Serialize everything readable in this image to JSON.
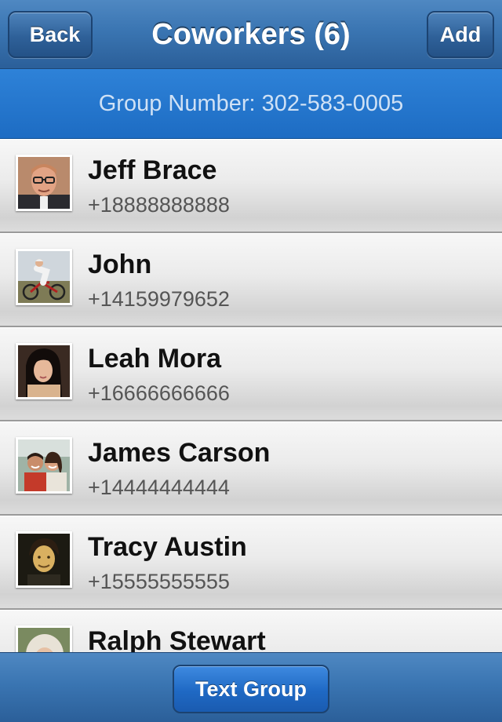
{
  "navbar": {
    "back_label": "Back",
    "title": "Coworkers (6)",
    "add_label": "Add"
  },
  "group": {
    "number_text": "Group Number: 302-583-0005"
  },
  "contacts": [
    {
      "name": "Jeff Brace",
      "phone": "+18888888888",
      "avatar": "avatar-man-glasses"
    },
    {
      "name": "John",
      "phone": "+14159979652",
      "avatar": "avatar-cyclist"
    },
    {
      "name": "Leah Mora",
      "phone": "+16666666666",
      "avatar": "avatar-woman-dark-hair"
    },
    {
      "name": "James Carson",
      "phone": "+14444444444",
      "avatar": "avatar-two-people-outdoors"
    },
    {
      "name": "Tracy Austin",
      "phone": "+15555555555",
      "avatar": "avatar-man-dark-background"
    },
    {
      "name": "Ralph Stewart",
      "phone": "",
      "avatar": "avatar-light-haired"
    }
  ],
  "toolbar": {
    "text_group_label": "Text Group"
  },
  "colors": {
    "nav_blue": "#3a75b2",
    "banner_blue": "#1d6cc3",
    "banner_text": "#cfe1f5",
    "button_blue": "#1f69c4"
  }
}
